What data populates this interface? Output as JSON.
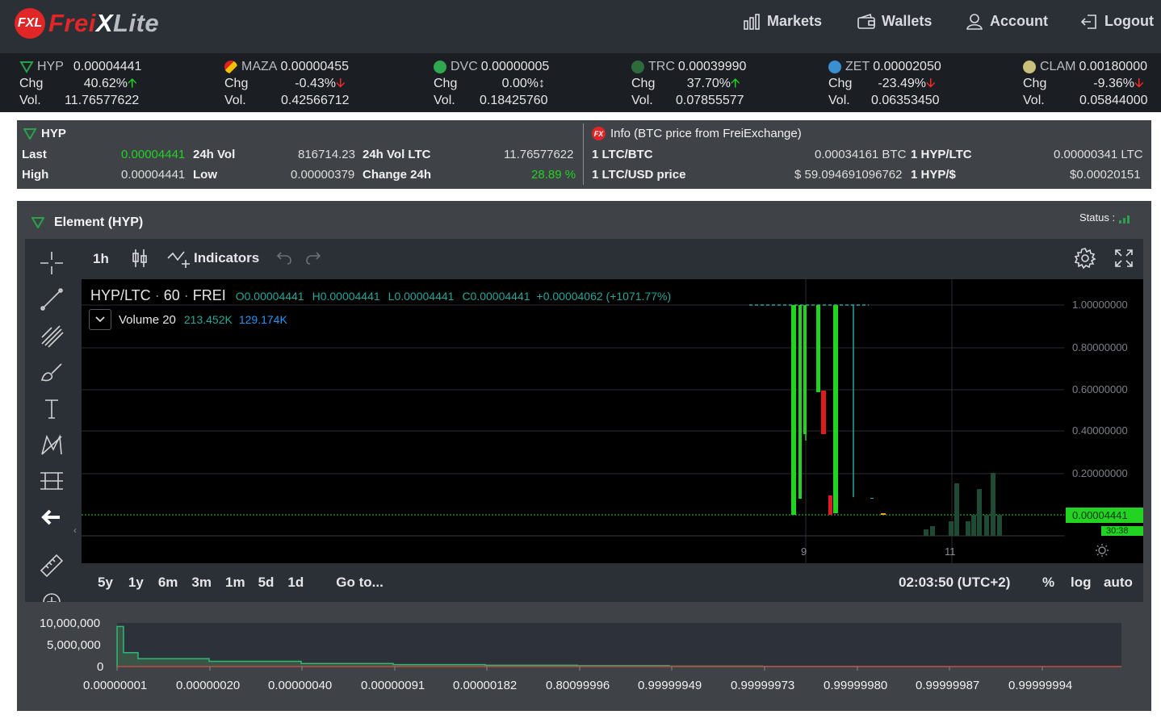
{
  "logo": {
    "badge": "FXL",
    "part1": "Frei",
    "part2": "X",
    "part3": "Lite"
  },
  "nav": [
    {
      "label": "Markets",
      "icon": "bar-chart-icon"
    },
    {
      "label": "Wallets",
      "icon": "wallet-icon"
    },
    {
      "label": "Account",
      "icon": "user-icon"
    },
    {
      "label": "Logout",
      "icon": "logout-icon"
    }
  ],
  "ticker": [
    {
      "symbol": "HYP",
      "price": "0.00004441",
      "chg_label": "Chg",
      "chg": "40.62%",
      "dir": "up",
      "vol_label": "Vol.",
      "vol": "11.76577622",
      "color": "#2aa14a"
    },
    {
      "symbol": "MAZA",
      "price": "0.00000455",
      "chg_label": "Chg",
      "chg": "-0.43%",
      "dir": "down",
      "vol_label": "Vol.",
      "vol": "0.42566712",
      "color": "#e0b020"
    },
    {
      "symbol": "DVC",
      "price": "0.00000005",
      "chg_label": "Chg",
      "chg": "0.00%",
      "dir": "flat",
      "vol_label": "Vol.",
      "vol": "0.18425760",
      "color": "#2fa84f"
    },
    {
      "symbol": "TRC",
      "price": "0.00039990",
      "chg_label": "Chg",
      "chg": "37.70%",
      "dir": "up",
      "vol_label": "Vol.",
      "vol": "0.07855577",
      "color": "#2f6b3a"
    },
    {
      "symbol": "ZET",
      "price": "0.00002050",
      "chg_label": "Chg",
      "chg": "-23.49%",
      "dir": "down",
      "vol_label": "Vol.",
      "vol": "0.06353450",
      "color": "#3a8fd0"
    },
    {
      "symbol": "CLAM",
      "price": "0.00180000",
      "chg_label": "Chg",
      "chg": "-9.36%",
      "dir": "down",
      "vol_label": "Vol.",
      "vol": "0.05844000",
      "color": "#c9c07a"
    }
  ],
  "info": {
    "symbol": "HYP",
    "last_label": "Last",
    "last": "0.00004441",
    "vol24_label": "24h Vol",
    "vol24": "816714.23",
    "vol24ltc_label": "24h Vol LTC",
    "vol24ltc": "11.76577622",
    "high_label": "High",
    "high": "0.00004441",
    "low_label": "Low",
    "low": "0.00000379",
    "change_label": "Change 24h",
    "change": "28.89 %",
    "fx_title": "Info (BTC price from FreiExchange)",
    "ltcbtc_label": "1 LTC/BTC",
    "ltcbtc": "0.00034161 BTC",
    "hypltc_label": "1 HYP/LTC",
    "hypltc": "0.00000341 LTC",
    "ltcusd_label": "1 LTC/USD price",
    "ltcusd": "$ 59.094691096762",
    "hypusd_label": "1 HYP/$",
    "hypusd": "$0.00020151"
  },
  "element": {
    "title": "Element (HYP)",
    "status_label": "Status :"
  },
  "toolbar": {
    "interval": "1h",
    "indicators": "Indicators"
  },
  "legend": {
    "pair": "HYP/LTC",
    "tf": "60",
    "exchange": "FREI",
    "o": "O0.00004441",
    "h": "H0.00004441",
    "l": "L0.00004441",
    "c": "C0.00004441",
    "change": "+0.00004062 (+1071.77%)",
    "volume_label": "Volume 20",
    "vol_a": "213.452K",
    "vol_b": "129.174K"
  },
  "price_axis": [
    "1.00000000",
    "0.80000000",
    "0.60000000",
    "0.40000000",
    "0.20000000"
  ],
  "last_price_tag": "0.00004441",
  "countdown_tag": "30:38",
  "time_axis": [
    "9",
    "11"
  ],
  "bottom_bar": {
    "ranges": [
      "5y",
      "1y",
      "6m",
      "3m",
      "1m",
      "5d",
      "1d"
    ],
    "goto": "Go to...",
    "clock": "02:03:50 (UTC+2)",
    "pct": "%",
    "log": "log",
    "auto": "auto"
  },
  "chart_data": {
    "type": "area",
    "title": "",
    "y_ticks": [
      "10,000,000",
      "5,000,000",
      "0"
    ],
    "x": [
      "0.00000001",
      "0.00000020",
      "0.00000040",
      "0.00000091",
      "0.00000182",
      "0.80099996",
      "0.99999949",
      "0.99999973",
      "0.99999980",
      "0.99999987",
      "0.99999994"
    ],
    "bid_depth": [
      9200000,
      3200000,
      1800000,
      1200000,
      700000,
      450000,
      300000,
      200000,
      100000,
      50000,
      20000,
      0
    ]
  }
}
